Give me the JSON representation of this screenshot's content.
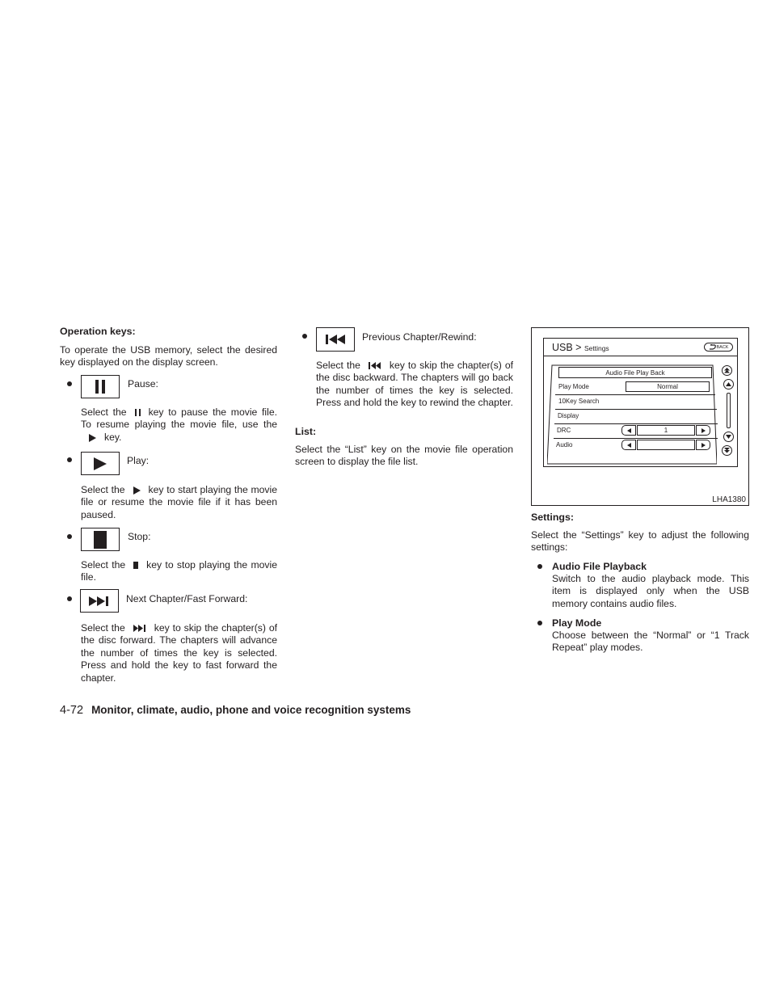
{
  "left_column": {
    "heading": "Operation keys:",
    "intro": "To operate the USB memory, select the desired key displayed on the display screen.",
    "keys": [
      {
        "icon": "pause-icon",
        "label": "Pause:",
        "desc_before": "Select the",
        "desc_after": "key to pause the movie file. To resume playing the movie file, use the",
        "desc_icon2": "play-icon",
        "desc_end": "key."
      },
      {
        "icon": "play-icon",
        "label": "Play:",
        "desc_before": "Select the",
        "desc_after": "key to start playing the movie file or resume the movie file if it has been paused."
      },
      {
        "icon": "stop-icon",
        "label": "Stop:",
        "desc_before": "Select the",
        "desc_after": "key to stop playing the movie file."
      },
      {
        "icon": "next-chapter-icon",
        "label": "Next Chapter/Fast Forward:",
        "desc_before": "Select the",
        "desc_after": "key to skip the chapter(s) of the disc forward. The chapters will advance the number of times the key is selected. Press and hold the key to fast forward the chapter."
      }
    ]
  },
  "middle_column": {
    "keys": [
      {
        "icon": "previous-chapter-icon",
        "label": "Previous Chapter/Rewind:",
        "desc_before": "Select the",
        "desc_after": "key to skip the chapter(s) of the disc backward. The chapters will go back the number of times the key is selected. Press and hold the key to rewind the chapter."
      }
    ],
    "list_heading": "List:",
    "list_text": "Select the “List” key on the movie file operation screen to display the file list."
  },
  "screen": {
    "title_main": "USB >",
    "title_sub": "Settings",
    "back_label": "BACK",
    "menu": [
      {
        "label": "Audio File Play Back"
      },
      {
        "label": "Play Mode",
        "value": "Normal"
      },
      {
        "label": "10Key Search"
      },
      {
        "label": "Display"
      },
      {
        "label": "DRC",
        "value": "1"
      },
      {
        "label": "Audio",
        "value": ""
      }
    ],
    "figure_id": "LHA1380"
  },
  "right_column": {
    "heading": "Settings:",
    "intro": "Select the “Settings” key to adjust the following settings:",
    "items": [
      {
        "title": "Audio File Playback",
        "text": "Switch to the audio playback mode. This item is displayed only when the USB memory contains audio files."
      },
      {
        "title": "Play Mode",
        "text": "Choose between the “Normal” or “1 Track Repeat” play modes."
      }
    ]
  },
  "footer": {
    "page_number": "4-72",
    "section_title": "Monitor, climate, audio, phone and voice recognition systems"
  }
}
